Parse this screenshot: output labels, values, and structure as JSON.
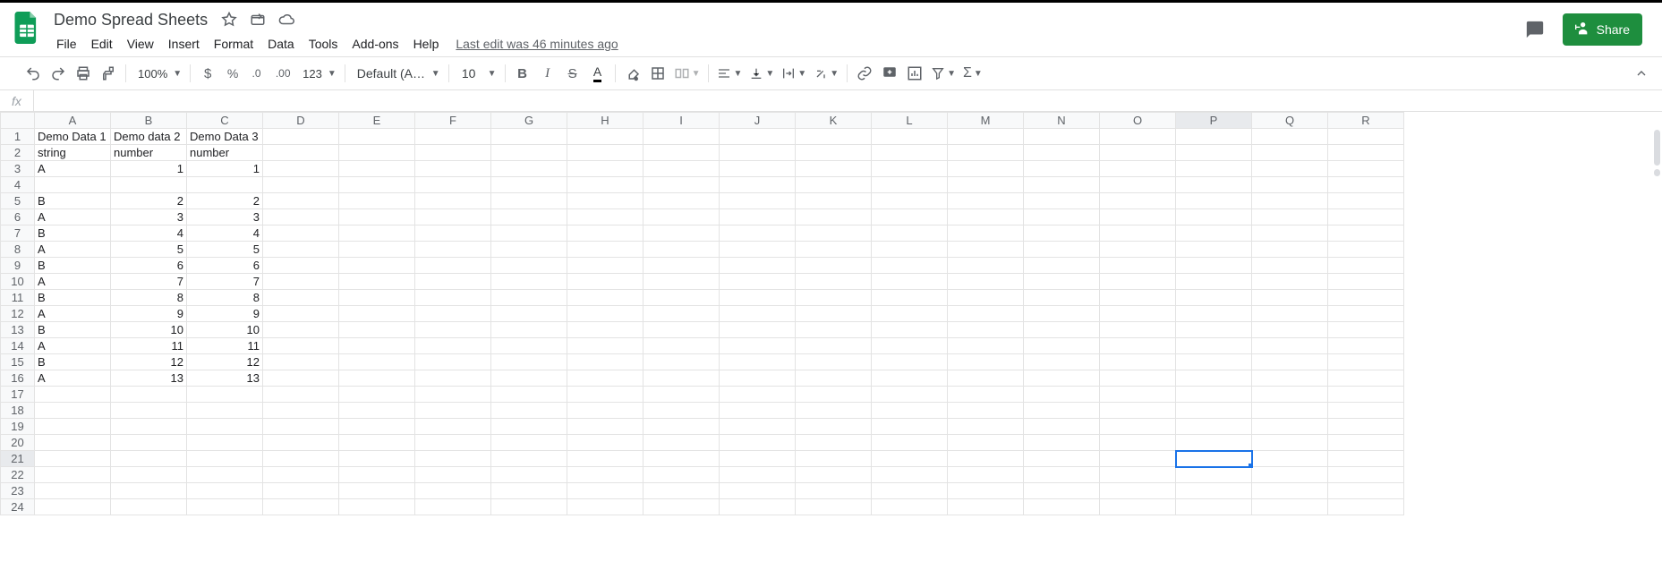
{
  "doc": {
    "title": "Demo Spread Sheets",
    "last_edit": "Last edit was 46 minutes ago"
  },
  "menus": [
    "File",
    "Edit",
    "View",
    "Insert",
    "Format",
    "Data",
    "Tools",
    "Add-ons",
    "Help"
  ],
  "share_label": "Share",
  "toolbar": {
    "zoom": "100%",
    "font": "Default (Ari...",
    "font_size": "10",
    "number_fmt": "123"
  },
  "formula_bar": {
    "fx": "fx",
    "value": ""
  },
  "grid": {
    "columns": [
      "A",
      "B",
      "C",
      "D",
      "E",
      "F",
      "G",
      "H",
      "I",
      "J",
      "K",
      "L",
      "M",
      "N",
      "O",
      "P",
      "Q",
      "R"
    ],
    "num_rows": 24,
    "selected": {
      "row": 21,
      "col": "P"
    },
    "data": {
      "1": {
        "A": "Demo Data 1",
        "B": "Demo data 2",
        "C": "Demo Data 3"
      },
      "2": {
        "A": "string",
        "B": "number",
        "C": "number"
      },
      "3": {
        "A": "A",
        "B": "1",
        "C": "1"
      },
      "4": {
        "A": ""
      },
      "5": {
        "A": "B",
        "B": "2",
        "C": "2"
      },
      "6": {
        "A": "A",
        "B": "3",
        "C": "3"
      },
      "7": {
        "A": "B",
        "B": "4",
        "C": "4"
      },
      "8": {
        "A": "A",
        "B": "5",
        "C": "5"
      },
      "9": {
        "A": "B",
        "B": "6",
        "C": "6"
      },
      "10": {
        "A": "A",
        "B": "7",
        "C": "7"
      },
      "11": {
        "A": "B",
        "B": "8",
        "C": "8"
      },
      "12": {
        "A": "A",
        "B": "9",
        "C": "9"
      },
      "13": {
        "A": "B",
        "B": "10",
        "C": "10"
      },
      "14": {
        "A": "A",
        "B": "11",
        "C": "11"
      },
      "15": {
        "A": "B",
        "B": "12",
        "C": "12"
      },
      "16": {
        "A": "A",
        "B": "13",
        "C": "13"
      }
    },
    "numeric_cols": [
      "B",
      "C"
    ]
  }
}
